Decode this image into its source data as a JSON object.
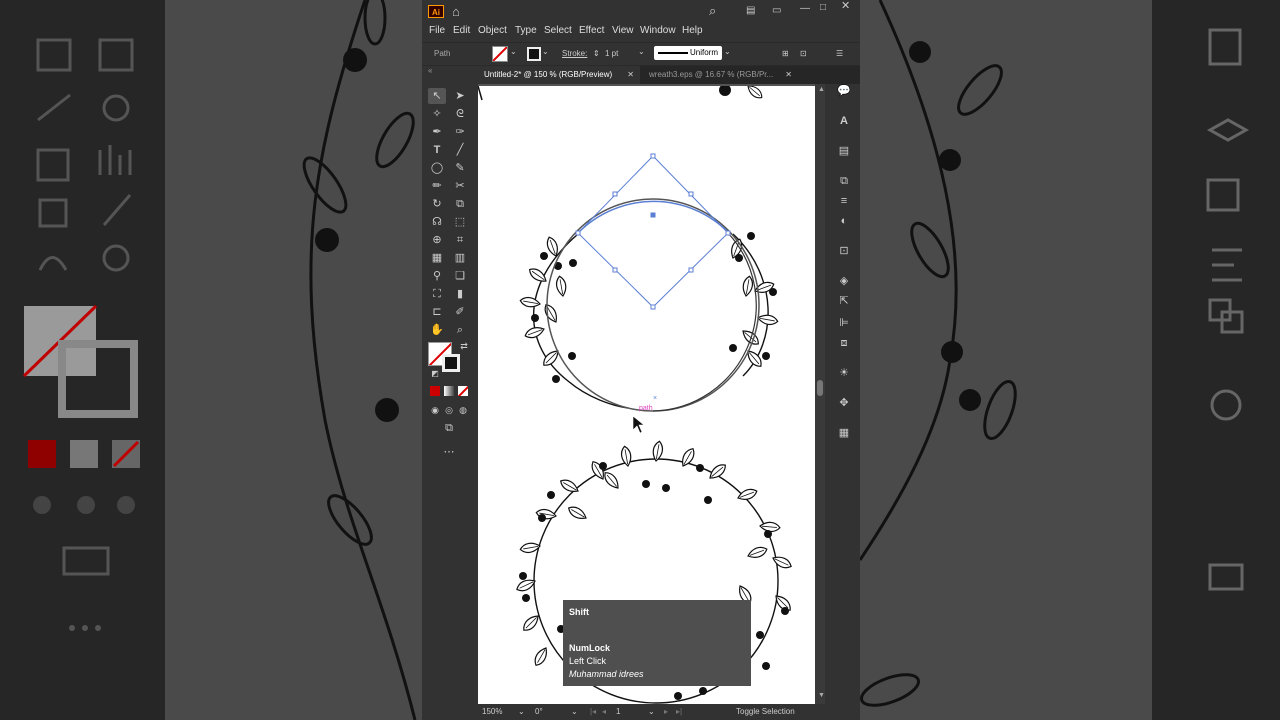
{
  "window": {
    "logo": "Ai"
  },
  "menu": [
    "File",
    "Edit",
    "Object",
    "Type",
    "Select",
    "Effect",
    "View",
    "Window",
    "Help"
  ],
  "control": {
    "selection_label": "Path",
    "stroke_label": "Stroke:",
    "stroke_weight": "1 pt",
    "profile": "Uniform"
  },
  "tabs": [
    {
      "label": "Untitled-2* @ 150 % (RGB/Preview)"
    },
    {
      "label": "wreath3.eps @ 16.67 % (RGB/Pr..."
    }
  ],
  "canvas": {
    "hover_label": "path"
  },
  "status": {
    "zoom": "150%",
    "rotation": "0°",
    "artboard": "1",
    "mode": "Toggle Selection"
  },
  "keystrokes": {
    "key1": "Shift",
    "key2": "NumLock",
    "key3": "Left Click",
    "credit": "Muhammad idrees"
  },
  "colors": {
    "accent": "#5b7fd3",
    "fill_red": "#cc0000",
    "ui_bg": "#323232"
  }
}
